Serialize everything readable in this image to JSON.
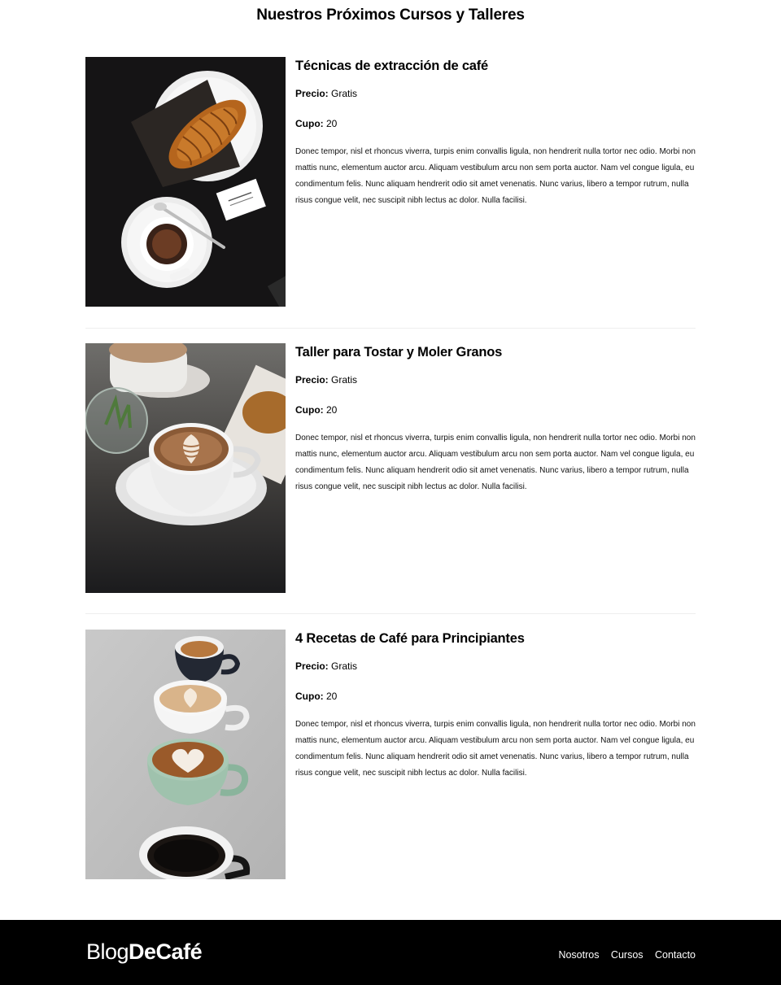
{
  "page": {
    "title": "Nuestros Próximos Cursos y Talleres"
  },
  "courses": [
    {
      "title": "Técnicas de extracción de café",
      "price_label": "Precio:",
      "price_value": "Gratis",
      "cupo_label": "Cupo:",
      "cupo_value": "20",
      "description": "Donec tempor, nisl et rhoncus viverra, turpis enim convallis ligula, non hendrerit nulla tortor nec odio. Morbi non mattis nunc, elementum auctor arcu. Aliquam vestibulum arcu non sem porta auctor. Nam vel congue ligula, eu condimentum felis. Nunc aliquam hendrerit odio sit amet venenatis. Nunc varius, libero a tempor rutrum, nulla risus congue velit, nec suscipit nibh lectus ac dolor. Nulla facilisi."
    },
    {
      "title": "Taller para Tostar y Moler Granos",
      "price_label": "Precio:",
      "price_value": "Gratis",
      "cupo_label": "Cupo:",
      "cupo_value": "20",
      "description": "Donec tempor, nisl et rhoncus viverra, turpis enim convallis ligula, non hendrerit nulla tortor nec odio. Morbi non mattis nunc, elementum auctor arcu. Aliquam vestibulum arcu non sem porta auctor. Nam vel congue ligula, eu condimentum felis. Nunc aliquam hendrerit odio sit amet venenatis. Nunc varius, libero a tempor rutrum, nulla risus congue velit, nec suscipit nibh lectus ac dolor. Nulla facilisi."
    },
    {
      "title": "4 Recetas de Café para Principiantes",
      "price_label": "Precio:",
      "price_value": "Gratis",
      "cupo_label": "Cupo:",
      "cupo_value": "20",
      "description": "Donec tempor, nisl et rhoncus viverra, turpis enim convallis ligula, non hendrerit nulla tortor nec odio. Morbi non mattis nunc, elementum auctor arcu. Aliquam vestibulum arcu non sem porta auctor. Nam vel congue ligula, eu condimentum felis. Nunc aliquam hendrerit odio sit amet venenatis. Nunc varius, libero a tempor rutrum, nulla risus congue velit, nec suscipit nibh lectus ac dolor. Nulla facilisi."
    }
  ],
  "footer": {
    "logo_light": "Blog",
    "logo_bold": "DeCafé",
    "nav": [
      "Nosotros",
      "Cursos",
      "Contacto"
    ],
    "background": "#000000"
  }
}
